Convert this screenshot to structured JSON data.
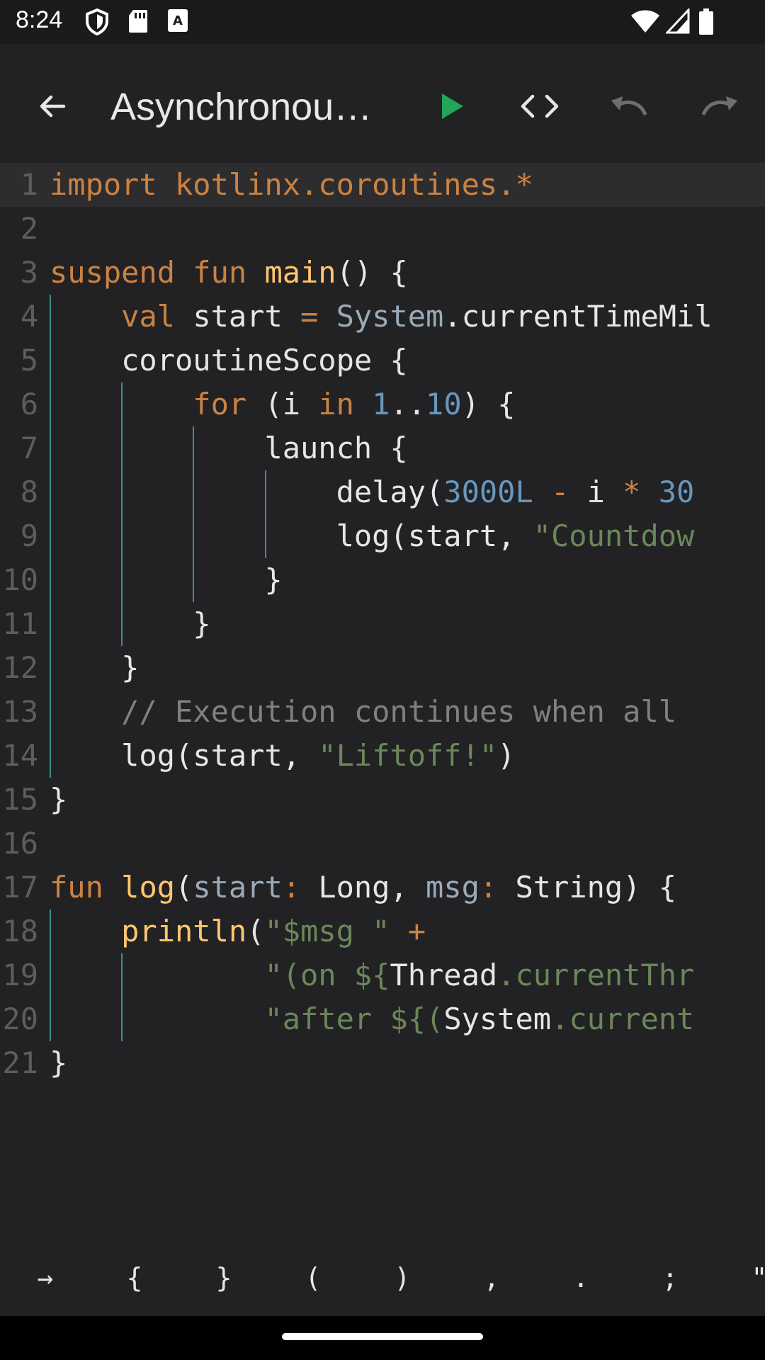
{
  "status_bar": {
    "time": "8:24",
    "left_icons": [
      "shield-icon",
      "sd-card-icon",
      "keyboard-a-icon"
    ],
    "right_icons": [
      "wifi-icon",
      "signal-icon",
      "battery-icon"
    ]
  },
  "toolbar": {
    "title": "Asynchronou…",
    "actions": [
      "back-arrow-icon",
      "run-icon",
      "code-icon",
      "undo-icon",
      "redo-icon"
    ],
    "run_color": "#21a65a"
  },
  "theme": {
    "keyword": "#cc8242",
    "function": "#ffc66d",
    "number": "#6897bb",
    "string": "#6a8759",
    "comment": "#808080",
    "plain": "#e6e6e6",
    "type": "#9aaab8",
    "guide": "#3d8f86"
  },
  "editor": {
    "active_line": 1,
    "lines": [
      {
        "n": "1",
        "tokens": [
          {
            "t": "import kotlinx.coroutines.*",
            "c": "keyword"
          }
        ]
      },
      {
        "n": "2",
        "tokens": []
      },
      {
        "n": "3",
        "tokens": [
          {
            "t": "suspend fun ",
            "c": "keyword"
          },
          {
            "t": "main",
            "c": "function"
          },
          {
            "t": "() {",
            "c": "plain"
          }
        ]
      },
      {
        "n": "4",
        "tokens": [
          {
            "t": "    ",
            "c": "plain"
          },
          {
            "t": "val ",
            "c": "keyword"
          },
          {
            "t": "start ",
            "c": "plain"
          },
          {
            "t": "= ",
            "c": "keyword"
          },
          {
            "t": "System",
            "c": "type"
          },
          {
            "t": ".currentTimeMil",
            "c": "plain"
          }
        ]
      },
      {
        "n": "5",
        "tokens": [
          {
            "t": "    coroutineScope {",
            "c": "plain"
          }
        ]
      },
      {
        "n": "6",
        "tokens": [
          {
            "t": "        ",
            "c": "plain"
          },
          {
            "t": "for ",
            "c": "keyword"
          },
          {
            "t": "(i ",
            "c": "plain"
          },
          {
            "t": "in ",
            "c": "keyword"
          },
          {
            "t": "1",
            "c": "number"
          },
          {
            "t": "..",
            "c": "plain"
          },
          {
            "t": "10",
            "c": "number"
          },
          {
            "t": ") {",
            "c": "plain"
          }
        ]
      },
      {
        "n": "7",
        "tokens": [
          {
            "t": "            launch {",
            "c": "plain"
          }
        ]
      },
      {
        "n": "8",
        "tokens": [
          {
            "t": "                delay(",
            "c": "plain"
          },
          {
            "t": "3000L ",
            "c": "number"
          },
          {
            "t": "- ",
            "c": "keyword"
          },
          {
            "t": "i ",
            "c": "plain"
          },
          {
            "t": "* ",
            "c": "keyword"
          },
          {
            "t": "30",
            "c": "number"
          }
        ]
      },
      {
        "n": "9",
        "tokens": [
          {
            "t": "                log(start, ",
            "c": "plain"
          },
          {
            "t": "\"Countdow",
            "c": "string"
          }
        ]
      },
      {
        "n": "10",
        "tokens": [
          {
            "t": "            }",
            "c": "plain"
          }
        ]
      },
      {
        "n": "11",
        "tokens": [
          {
            "t": "        }",
            "c": "plain"
          }
        ]
      },
      {
        "n": "12",
        "tokens": [
          {
            "t": "    }",
            "c": "plain"
          }
        ]
      },
      {
        "n": "13",
        "tokens": [
          {
            "t": "    // Execution continues when all",
            "c": "comment"
          }
        ]
      },
      {
        "n": "14",
        "tokens": [
          {
            "t": "    log(start, ",
            "c": "plain"
          },
          {
            "t": "\"Liftoff!\"",
            "c": "string"
          },
          {
            "t": ")",
            "c": "plain"
          }
        ]
      },
      {
        "n": "15",
        "tokens": [
          {
            "t": "}",
            "c": "plain"
          }
        ]
      },
      {
        "n": "16",
        "tokens": []
      },
      {
        "n": "17",
        "tokens": [
          {
            "t": "fun ",
            "c": "keyword"
          },
          {
            "t": "log",
            "c": "function"
          },
          {
            "t": "(",
            "c": "plain"
          },
          {
            "t": "start",
            "c": "type"
          },
          {
            "t": ": ",
            "c": "keyword"
          },
          {
            "t": "Long, ",
            "c": "plain"
          },
          {
            "t": "msg",
            "c": "type"
          },
          {
            "t": ": ",
            "c": "keyword"
          },
          {
            "t": "String) {",
            "c": "plain"
          }
        ]
      },
      {
        "n": "18",
        "tokens": [
          {
            "t": "    ",
            "c": "plain"
          },
          {
            "t": "println",
            "c": "function"
          },
          {
            "t": "(",
            "c": "plain"
          },
          {
            "t": "\"$msg \" ",
            "c": "string"
          },
          {
            "t": "+",
            "c": "keyword"
          }
        ]
      },
      {
        "n": "19",
        "tokens": [
          {
            "t": "            ",
            "c": "plain"
          },
          {
            "t": "\"(on ${",
            "c": "string"
          },
          {
            "t": "Thread",
            "c": "plain"
          },
          {
            "t": ".currentThr",
            "c": "string"
          }
        ]
      },
      {
        "n": "20",
        "tokens": [
          {
            "t": "            ",
            "c": "plain"
          },
          {
            "t": "\"after ${(",
            "c": "string"
          },
          {
            "t": "System",
            "c": "plain"
          },
          {
            "t": ".current",
            "c": "string"
          }
        ]
      },
      {
        "n": "21",
        "tokens": [
          {
            "t": "}",
            "c": "plain"
          }
        ]
      }
    ]
  },
  "symbol_bar": {
    "keys": [
      "→",
      "{",
      "}",
      "(",
      ")",
      ",",
      ".",
      ";",
      "\""
    ]
  }
}
